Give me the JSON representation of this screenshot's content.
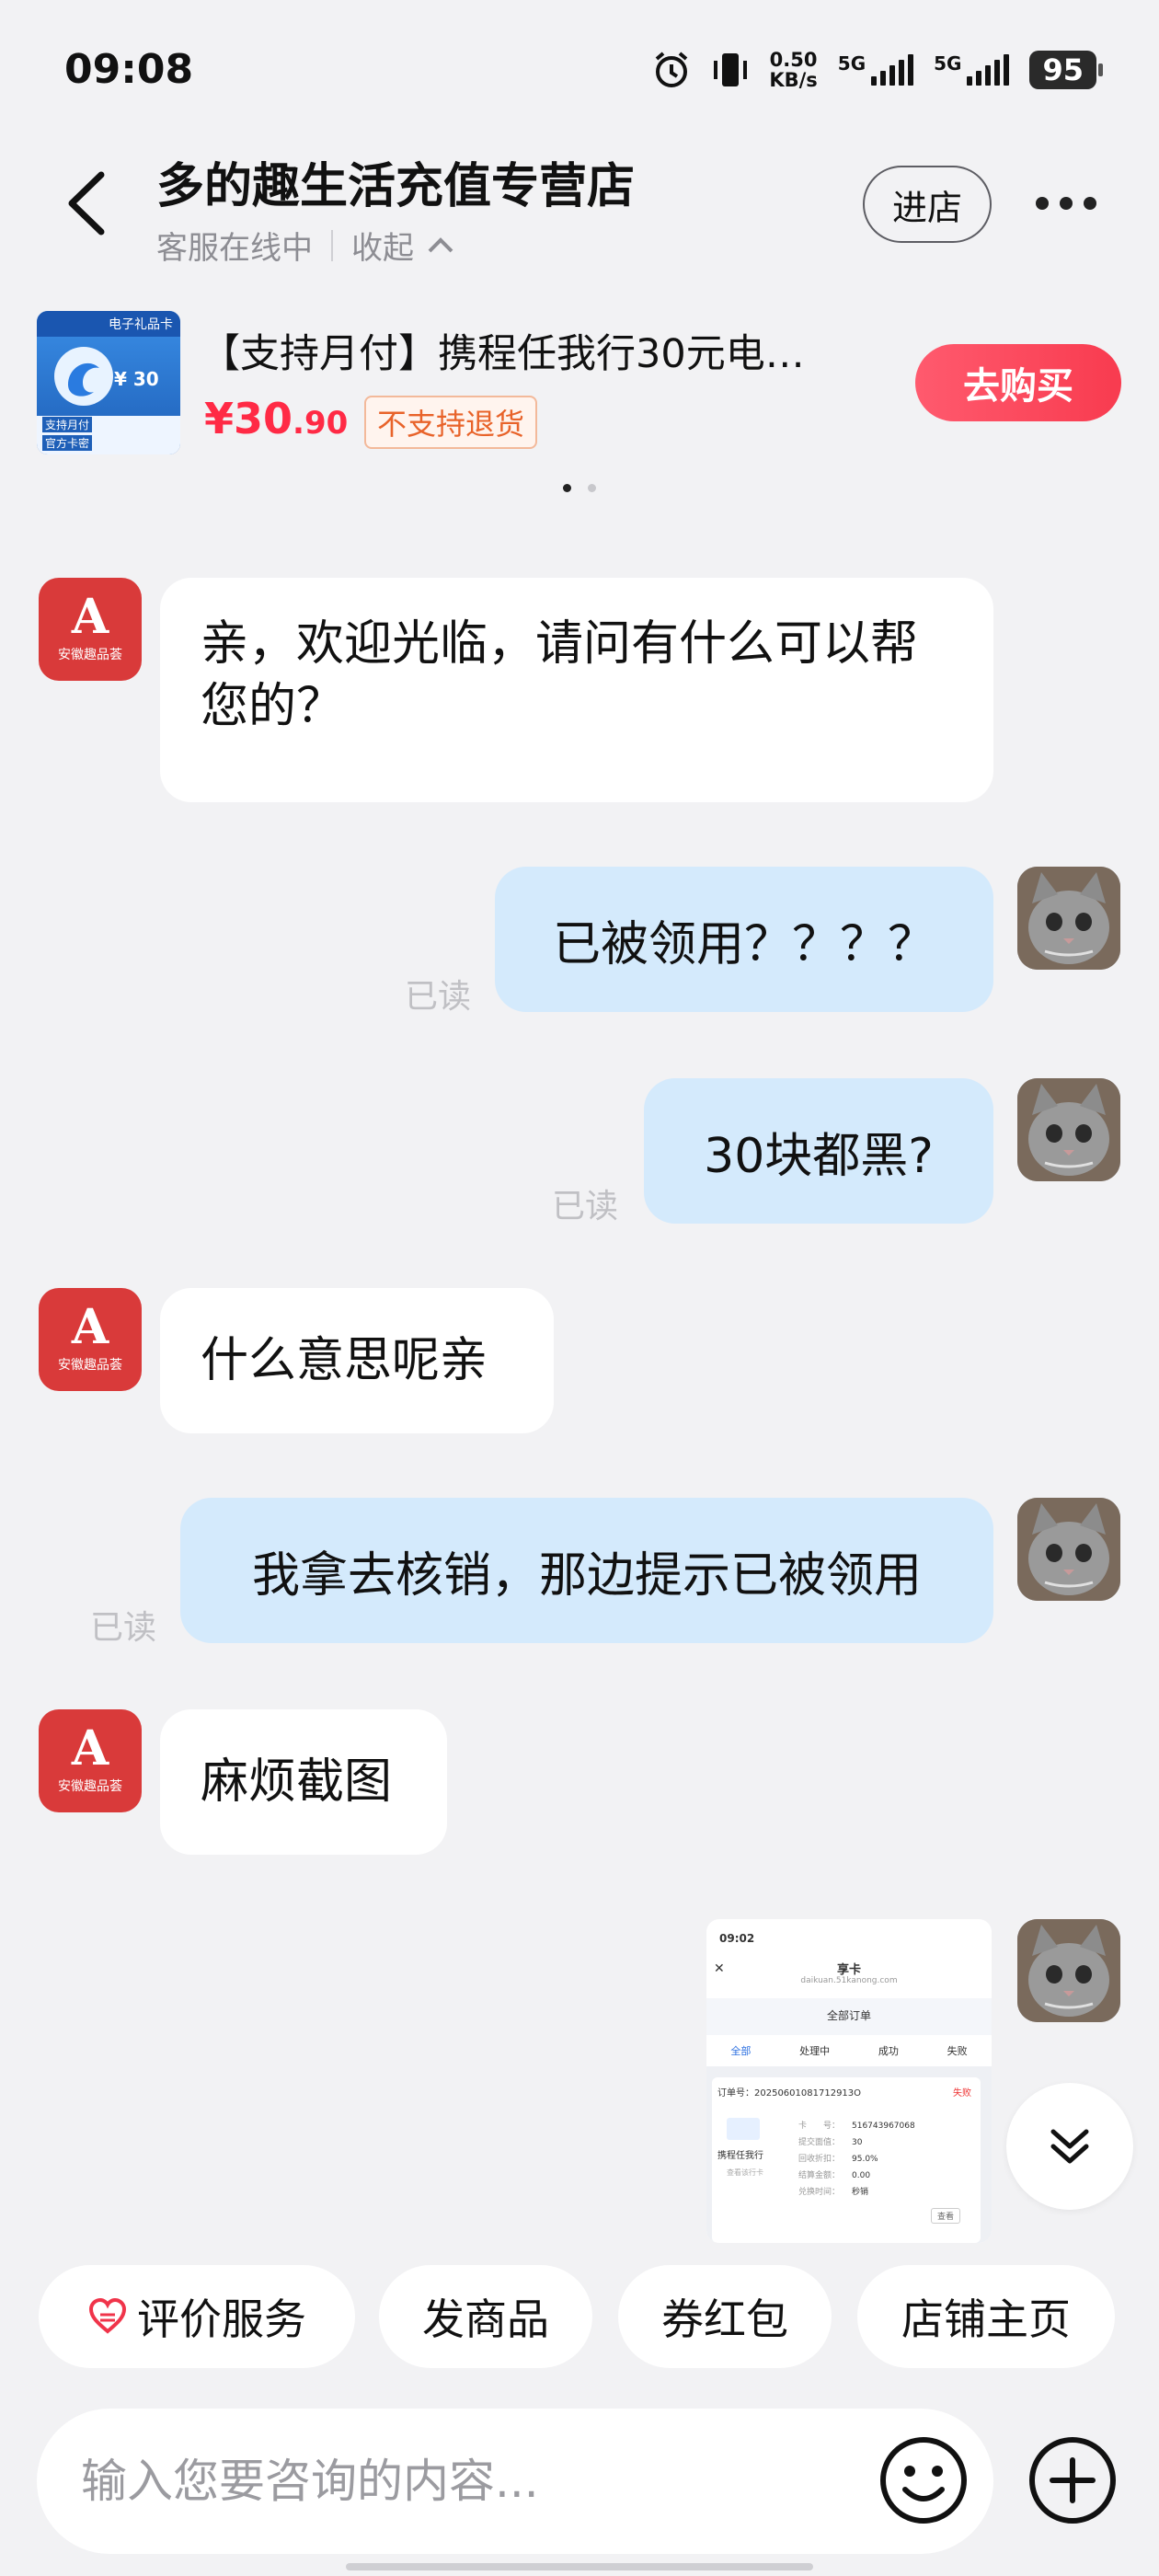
{
  "status": {
    "time": "09:08",
    "speed": "0.50",
    "speed_unit": "KB/s",
    "net1": "5G",
    "net2": "5G",
    "battery": "95"
  },
  "header": {
    "shop_name": "多的趣生活充值专营店",
    "online_status": "客服在线中",
    "collapse_label": "收起",
    "enter_store": "进店"
  },
  "product": {
    "title": "【支持月付】携程任我行30元电…",
    "price_main": "¥30",
    "price_decimal": ".90",
    "no_return": "不支持退货",
    "buy_label": "去购买",
    "image_value": "¥ 30",
    "image_label_left": "支持月付",
    "image_label_left2": "官方卡密",
    "image_brand": "电子礼品卡"
  },
  "shop_avatar_text": {
    "letter": "A",
    "caption": "安徽趣品荟"
  },
  "messages": [
    {
      "side": "left",
      "text": "亲，欢迎光临，请问有什么可以帮您的？"
    },
    {
      "side": "right",
      "text": "已被领用？？？？",
      "read": "已读"
    },
    {
      "side": "right",
      "text": "30块都黑?",
      "read": "已读"
    },
    {
      "side": "left",
      "text": "什么意思呢亲"
    },
    {
      "side": "right",
      "text": "我拿去核销，那边提示已被领用",
      "read": "已读"
    },
    {
      "side": "left",
      "text": "麻烦截图"
    }
  ],
  "screenshot": {
    "time": "09:02",
    "app_title": "享卡",
    "url": "daikuan.51kanong.com",
    "page_title": "全部订单",
    "tabs": [
      "全部",
      "处理中",
      "成功",
      "失败"
    ],
    "order_no": "订单号：20250601081712913O",
    "order_status": "失败",
    "card_name": "携程任我行",
    "card_sub": "查看该行卡",
    "fields": [
      "卡　　号：",
      "提交面值：",
      "回收折扣：",
      "结算金额：",
      "兑换时间："
    ],
    "values": [
      "516743967068",
      "30",
      "95.0%",
      "0.00",
      "秒销"
    ],
    "view": "查看"
  },
  "quick_actions": {
    "rate": "评价服务",
    "send_product": "发商品",
    "coupon": "券红包",
    "store_home": "店铺主页"
  },
  "input": {
    "placeholder": "输入您要咨询的内容..."
  },
  "colors": {
    "accent": "#f83b4f",
    "bubble_right": "#d4eafc",
    "shop_avatar": "#d93a3a"
  }
}
